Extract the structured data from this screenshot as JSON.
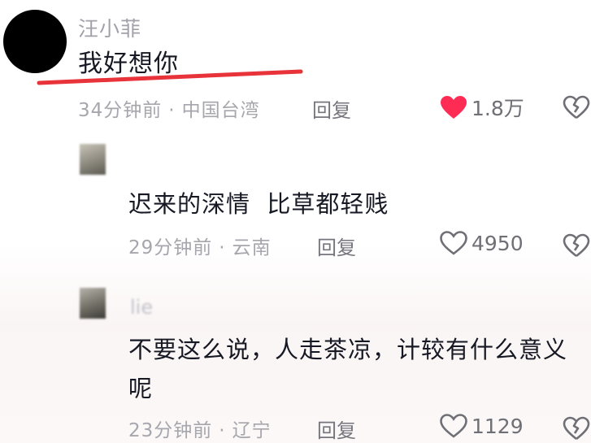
{
  "comments": [
    {
      "username": "汪小菲",
      "text": "我好想你",
      "time": "34分钟前",
      "location": "中国台湾",
      "reply_label": "回复",
      "likes": "1.8万",
      "liked": true
    },
    {
      "username": "",
      "text": "迟来的深情  比草都轻贱",
      "time": "29分钟前",
      "location": "云南",
      "reply_label": "回复",
      "likes": "4950",
      "liked": false
    },
    {
      "username": "lie",
      "text": "不要这么说，人走茶凉，计较有什么意义呢",
      "time": "23分钟前",
      "location": "辽宁",
      "reply_label": "回复",
      "likes": "1129",
      "liked": false
    }
  ],
  "separator": "·",
  "colors": {
    "liked_heart": "#fe2c55",
    "underline": "#e8333b",
    "meta_text": "#a6a6ad"
  }
}
